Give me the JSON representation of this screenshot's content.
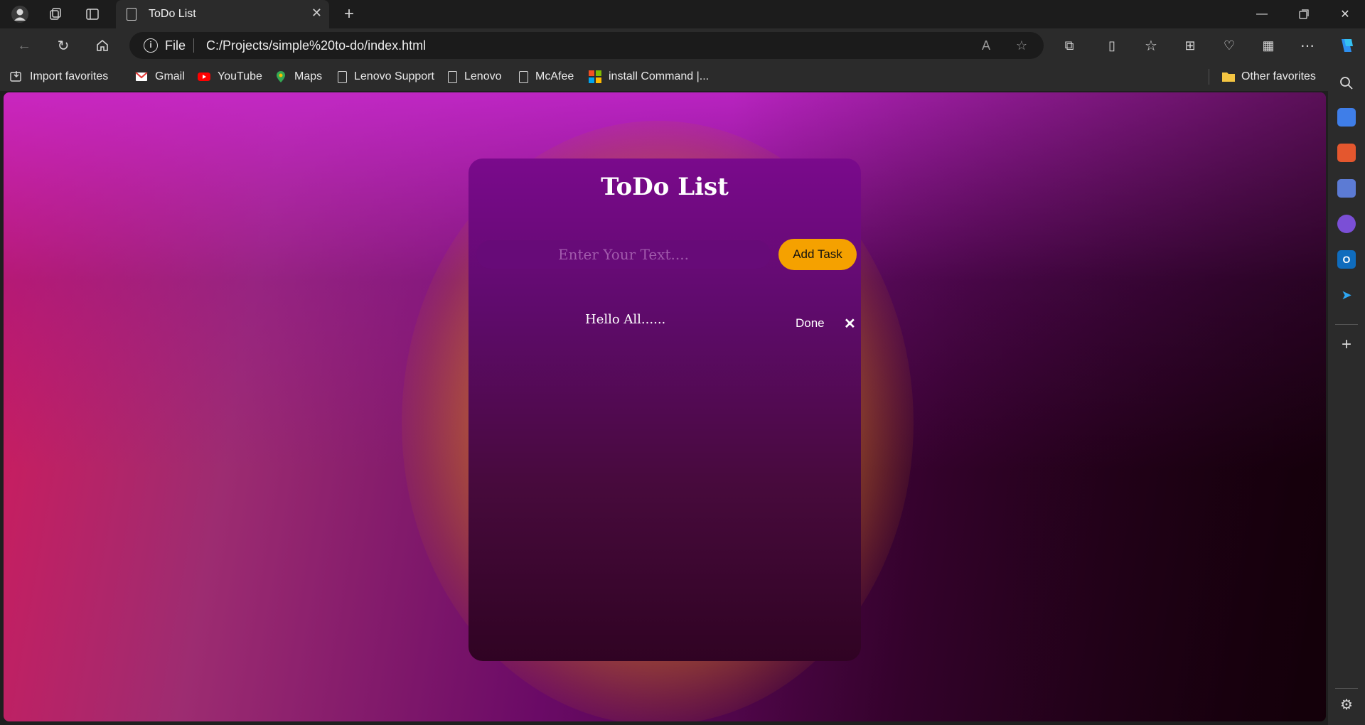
{
  "browser": {
    "tab": {
      "title": "ToDo List"
    },
    "address": {
      "scheme": "File",
      "url": "C:/Projects/simple%20to-do/index.html"
    },
    "favorites": [
      {
        "label": "Import favorites",
        "icon": "import-icon"
      },
      {
        "label": "Gmail",
        "icon": "gmail-icon"
      },
      {
        "label": "YouTube",
        "icon": "youtube-icon"
      },
      {
        "label": "Maps",
        "icon": "maps-pin-icon"
      },
      {
        "label": "Lenovo Support",
        "icon": "document-icon"
      },
      {
        "label": "Lenovo",
        "icon": "document-icon"
      },
      {
        "label": "McAfee",
        "icon": "document-icon"
      },
      {
        "label": "install Command |...",
        "icon": "microsoft-icon"
      }
    ],
    "other_favorites": "Other favorites"
  },
  "app": {
    "title": "ToDo List",
    "input_placeholder": "Enter Your Text....",
    "add_button": "Add Task",
    "tasks": [
      {
        "text": "Hello All......",
        "done_label": "Done",
        "delete_label": "✕"
      }
    ]
  },
  "colors": {
    "accent_button": "#f5a100",
    "card_top": "#7a0a8c",
    "glow": "#e19614"
  }
}
